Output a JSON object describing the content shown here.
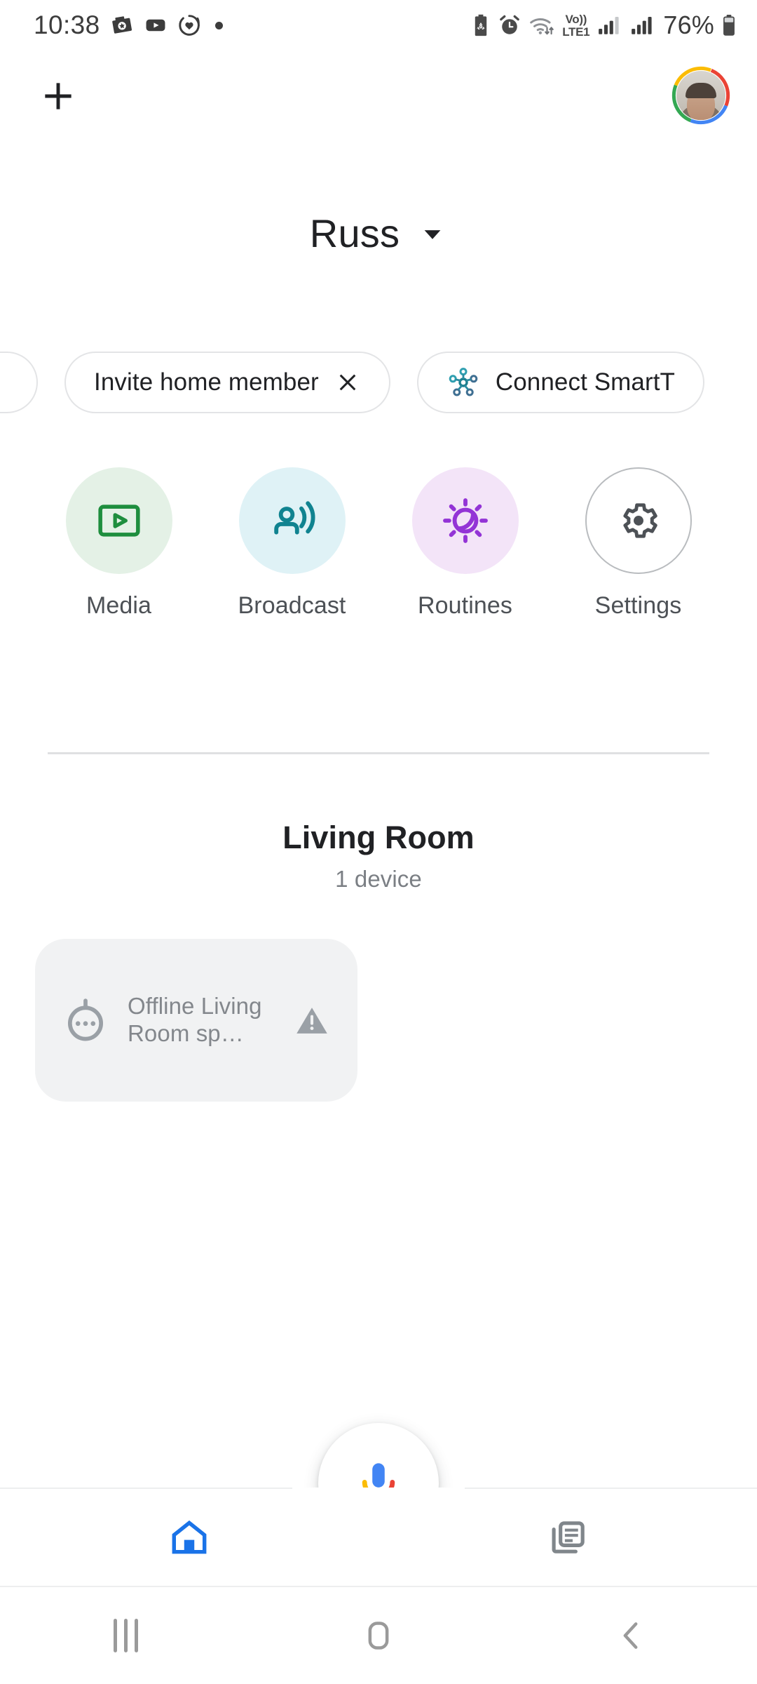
{
  "status_bar": {
    "time": "10:38",
    "left_icons": [
      "photos-icon",
      "youtube-icon",
      "heart-sync-icon",
      "dot-indicator"
    ],
    "network_label_line1": "Vo))",
    "network_label_line2": "LTE1",
    "battery_percent": "76%",
    "right_icons": [
      "battery-saver-icon",
      "alarm-icon",
      "wifi-data-icon",
      "volte-indicator",
      "signal-bars-sim1",
      "signal-bars-sim2",
      "battery-icon"
    ]
  },
  "app_bar": {
    "add_icon": "plus-icon",
    "avatar_label": "account-avatar"
  },
  "home": {
    "name": "Russ",
    "dropdown_icon": "chevron-down-icon"
  },
  "chips": [
    {
      "label": "Invite home member",
      "icon": "",
      "trailing_icon": "close-icon"
    },
    {
      "label": "Connect SmartT",
      "icon": "smartthings-icon",
      "trailing_icon": ""
    }
  ],
  "quick_actions": [
    {
      "label": "Media",
      "icon": "media-play-icon",
      "bubble_color": "#e4f1e6",
      "icon_color": "#1e8e3e"
    },
    {
      "label": "Broadcast",
      "icon": "broadcast-icon",
      "bubble_color": "#dff2f6",
      "icon_color": "#108390"
    },
    {
      "label": "Routines",
      "icon": "routines-sun-moon-icon",
      "bubble_color": "#f3e4f8",
      "icon_color": "#9334d6"
    },
    {
      "label": "Settings",
      "icon": "gear-icon",
      "bubble_color": "#ffffff",
      "icon_color": "#4d5156"
    }
  ],
  "room": {
    "name": "Living Room",
    "device_count": "1 device",
    "devices": [
      {
        "status": "Offline",
        "name": "Living Room sp…",
        "icon": "speaker-icon",
        "warning_icon": "warning-triangle-icon"
      }
    ]
  },
  "assistant": {
    "fab_icon": "google-assistant-mic-icon"
  },
  "bottom_nav": [
    {
      "label": "",
      "icon": "home-icon",
      "active": true,
      "color": "#1a73e8"
    },
    {
      "label": "",
      "icon": "feed-icon",
      "active": false,
      "color": "#80868b"
    }
  ],
  "system_nav": [
    {
      "icon": "recents-icon"
    },
    {
      "icon": "home-square-icon"
    },
    {
      "icon": "back-chevron-icon"
    }
  ],
  "colors": {
    "accent_blue": "#1a73e8",
    "text_primary": "#202124",
    "text_secondary": "#7b7f84",
    "card_bg": "#f1f2f3",
    "divider": "#dfe0e2"
  }
}
